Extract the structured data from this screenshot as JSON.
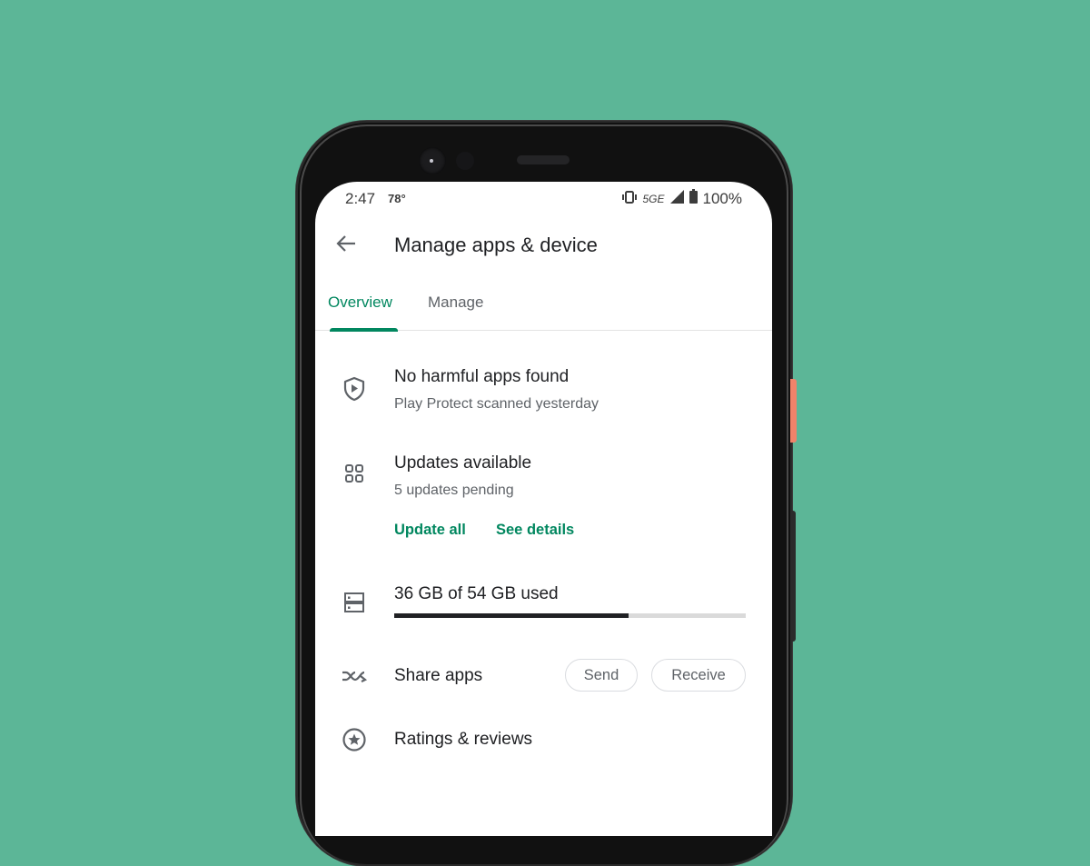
{
  "status_bar": {
    "time": "2:47",
    "temperature": "78°",
    "network": "5GE",
    "battery": "100%",
    "icons": [
      "vibrate-icon",
      "signal-icon",
      "battery-icon"
    ]
  },
  "header": {
    "back_icon": "arrow-left-icon",
    "title": "Manage apps & device"
  },
  "tabs": [
    {
      "label": "Overview",
      "active": true
    },
    {
      "label": "Manage",
      "active": false
    }
  ],
  "sections": {
    "protect": {
      "icon": "shield-play-icon",
      "title": "No harmful apps found",
      "subtitle": "Play Protect scanned yesterday"
    },
    "updates": {
      "icon": "apps-grid-icon",
      "title": "Updates available",
      "subtitle": "5 updates pending",
      "actions": [
        "Update all",
        "See details"
      ]
    },
    "storage": {
      "icon": "storage-icon",
      "title": "36 GB of 54 GB used",
      "used_gb": 36,
      "total_gb": 54,
      "used_fraction": 0.667
    },
    "share": {
      "icon": "share-swap-icon",
      "title": "Share apps",
      "send_label": "Send",
      "receive_label": "Receive"
    },
    "ratings": {
      "icon": "star-circle-icon",
      "title": "Ratings & reviews"
    }
  },
  "colors": {
    "background": "#5cb697",
    "accent": "#01875f",
    "side_button": "#f0836a"
  }
}
